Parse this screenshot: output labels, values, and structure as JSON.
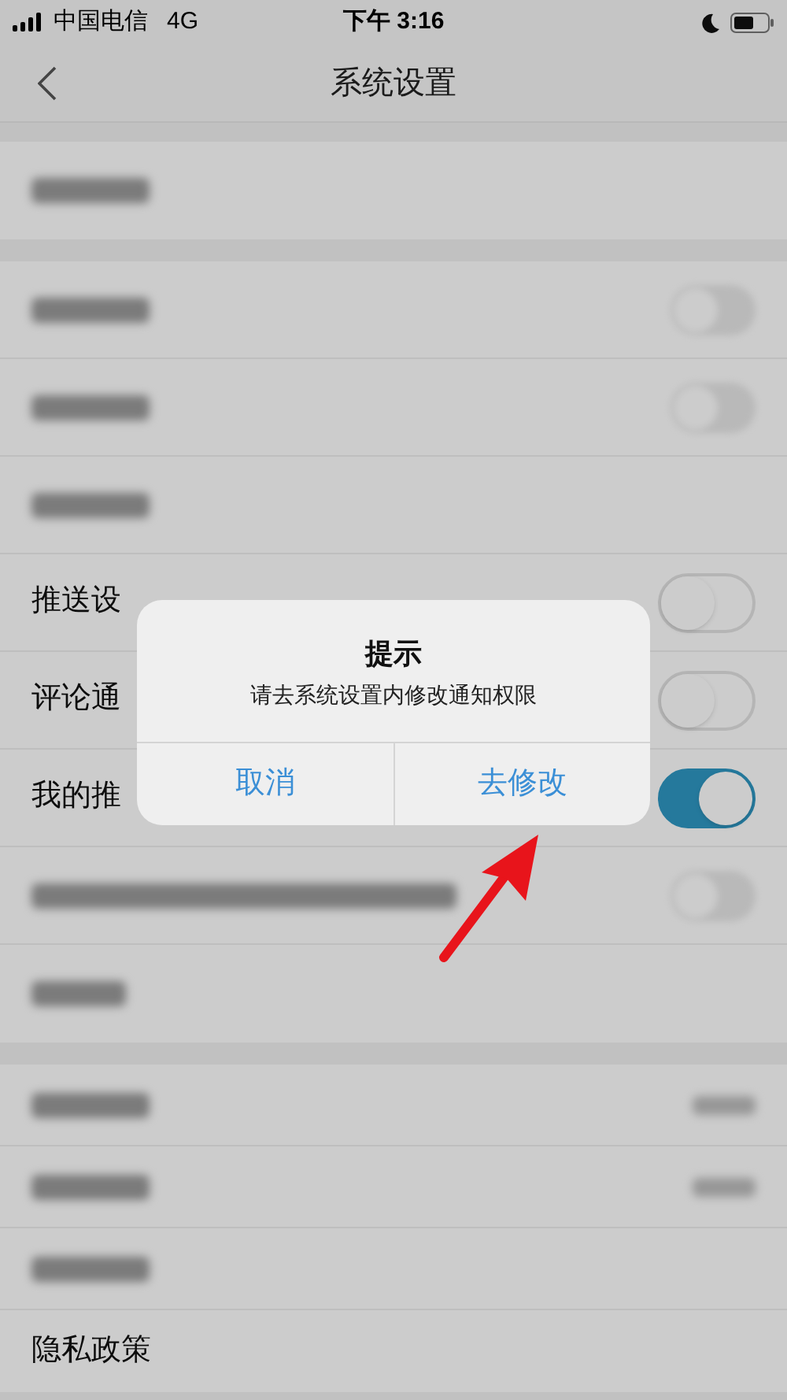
{
  "status_bar": {
    "carrier": "中国电信",
    "network": "4G",
    "time": "下午 3:16"
  },
  "nav": {
    "title": "系统设置"
  },
  "sections": [
    {
      "rows": [
        {
          "kind": "blurred"
        }
      ]
    },
    {
      "rows": [
        {
          "kind": "blurred_toggle",
          "on": false
        },
        {
          "kind": "blurred_toggle",
          "on": false
        },
        {
          "kind": "blurred"
        },
        {
          "kind": "toggle",
          "label": "推送设",
          "on": false
        },
        {
          "kind": "toggle",
          "label": "评论通",
          "on": false
        },
        {
          "kind": "toggle",
          "label": "我的推",
          "on": true
        },
        {
          "kind": "blurred_long_toggle",
          "on": false
        },
        {
          "kind": "blurred_short"
        }
      ]
    },
    {
      "rows": [
        {
          "kind": "blurred_value"
        },
        {
          "kind": "blurred_value"
        },
        {
          "kind": "blurred"
        },
        {
          "kind": "text",
          "label": "隐私政策"
        }
      ]
    }
  ],
  "dialog": {
    "title": "提示",
    "message": "请去系统设置内修改通知权限",
    "buttons": [
      "取消",
      "去修改"
    ]
  }
}
